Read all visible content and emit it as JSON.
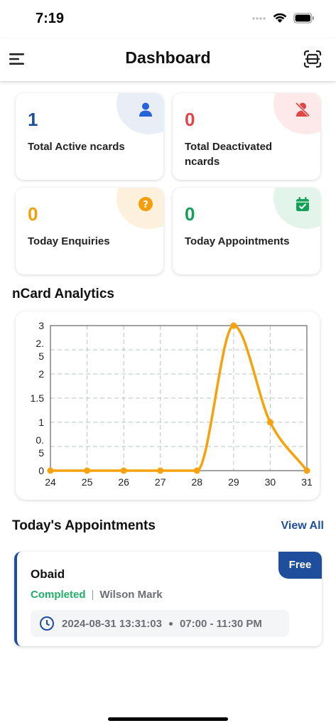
{
  "status_bar": {
    "time": "7:19"
  },
  "header": {
    "title": "Dashboard",
    "menu_icon": "menu-icon",
    "scan_icon": "scan-icon"
  },
  "stats": {
    "active": {
      "value": "1",
      "label": "Total Active ncards",
      "color": "#1f4e9c",
      "blob": "#e8edf6",
      "icon": "person-icon"
    },
    "deactivated": {
      "value": "0",
      "label": "Total Deactivated ncards",
      "color": "#e04646",
      "blob": "#fde9e9",
      "icon": "person-off-icon"
    },
    "enquiries": {
      "value": "0",
      "label": "Today Enquiries",
      "color": "#f59e0b",
      "blob": "#fdf1de",
      "icon": "question-icon"
    },
    "appointments": {
      "value": "0",
      "label": "Today Appointments",
      "color": "#15a05a",
      "blob": "#e3f5ea",
      "icon": "calendar-check-icon"
    }
  },
  "analytics": {
    "title": "nCard Analytics"
  },
  "chart_data": {
    "type": "line",
    "x": [
      "24",
      "25",
      "26",
      "27",
      "28",
      "29",
      "30",
      "31"
    ],
    "series": [
      {
        "values": [
          0,
          0,
          0,
          0,
          0,
          3,
          1,
          0
        ],
        "color": "#f5a20c"
      }
    ],
    "yticks": [
      "0",
      "0.\n5",
      "1",
      "1.5",
      "2",
      "2.\n5",
      "3"
    ],
    "ylim": [
      0,
      3
    ],
    "grid": true,
    "title": "",
    "xlabel": "",
    "ylabel": ""
  },
  "appointments": {
    "title": "Today's Appointments",
    "view_all": "View All",
    "items": [
      {
        "name": "Obaid",
        "status": "Completed",
        "separator": "|",
        "person": "Wilson Mark",
        "badge": "Free",
        "date": "2024-08-31 13:31:03",
        "time_range": "07:00 - 11:30 PM"
      }
    ]
  }
}
